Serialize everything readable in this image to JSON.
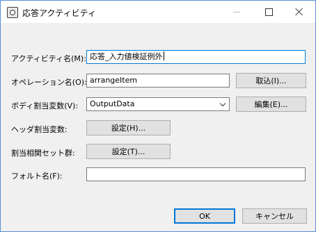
{
  "window": {
    "title": "応答アクティビティ"
  },
  "fields": {
    "activity_name_label": "アクティビティ名(M):",
    "activity_name_value": "応答_入力値検証例外",
    "operation_name_label": "オペレーション名(O):",
    "operation_name_value": "arrangeItem",
    "body_var_label": "ボディ割当変数(V):",
    "body_var_value": "OutputData",
    "header_var_label": "ヘッダ割当変数:",
    "correlation_label": "割当相関セット群:",
    "fault_name_label": "フォルト名(F):",
    "fault_name_value": ""
  },
  "buttons": {
    "import": "取込(I)...",
    "edit": "編集(E)...",
    "header_settings": "設定(H)...",
    "correlation_settings": "設定(T)...",
    "ok": "OK",
    "cancel": "キャンセル"
  }
}
